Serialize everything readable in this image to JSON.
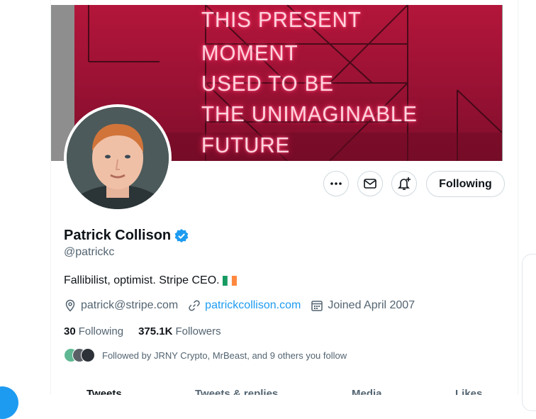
{
  "banner": {
    "neon_lines": [
      "THIS PRESENT",
      "MOMENT",
      "USED TO BE",
      "THE UNIMAGINABLE",
      "FUTURE"
    ]
  },
  "profile": {
    "name": "Patrick Collison",
    "handle": "@patrickc",
    "verified": true,
    "bio": "Fallibilist, optimist. Stripe CEO.",
    "bio_flag": "ireland-flag",
    "email": "patrick@stripe.com",
    "website": "patrickcollison.com",
    "joined": "Joined April 2007",
    "following_count": "30",
    "following_label": "Following",
    "followers_count": "375.1K",
    "followers_label": "Followers",
    "followed_by": "Followed by JRNY Crypto, MrBeast, and 9 others you follow"
  },
  "actions": {
    "more_icon": "more-dots-icon",
    "message_icon": "mail-icon",
    "notify_icon": "bell-plus-icon",
    "follow_label": "Following"
  },
  "tabs": [
    "Tweets",
    "Tweets & replies",
    "Media",
    "Likes"
  ],
  "colors": {
    "accent": "#1d9bf0",
    "text": "#0f1419",
    "secondary": "#536471",
    "banner": "#9d1235"
  }
}
